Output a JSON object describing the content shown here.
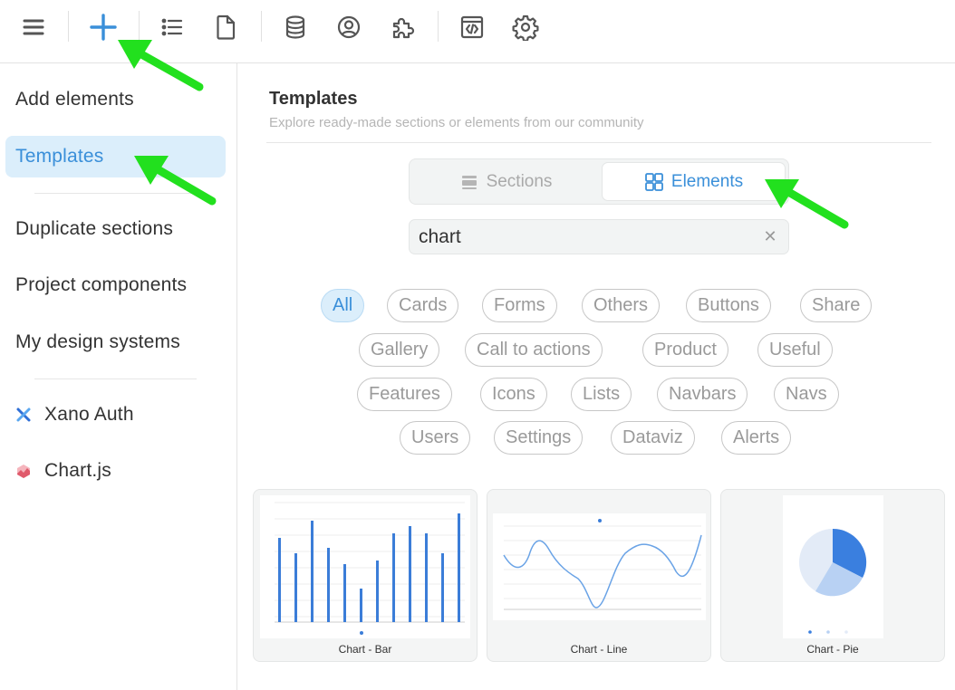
{
  "toolbar": {
    "buttons": [
      {
        "name": "menu-icon"
      },
      {
        "name": "plus-icon",
        "color": "#3a8fd9"
      },
      {
        "name": "list-icon"
      },
      {
        "name": "page-icon"
      },
      {
        "name": "database-icon"
      },
      {
        "name": "user-circle-icon"
      },
      {
        "name": "puzzle-icon"
      },
      {
        "name": "code-window-icon"
      },
      {
        "name": "gear-icon"
      }
    ]
  },
  "sidebar": {
    "items": [
      {
        "label": "Add elements"
      },
      {
        "label": "Templates",
        "active": true
      },
      {
        "label": "Duplicate sections"
      },
      {
        "label": "Project components"
      },
      {
        "label": "My design systems"
      }
    ],
    "extensions": [
      {
        "label": "Xano Auth",
        "icon": "xano-icon"
      },
      {
        "label": "Chart.js",
        "icon": "chartjs-icon"
      }
    ]
  },
  "main": {
    "title": "Templates",
    "subtitle": "Explore ready-made sections or elements from our community",
    "segments": {
      "sections": "Sections",
      "elements": "Elements",
      "selected": "Elements"
    },
    "search": {
      "value": "chart",
      "clear": "✕"
    },
    "tags": [
      "All",
      "Cards",
      "Forms",
      "Others",
      "Buttons",
      "Share",
      "Gallery",
      "Call to actions",
      "Product",
      "Useful",
      "Features",
      "Icons",
      "Lists",
      "Navbars",
      "Navs",
      "Users",
      "Settings",
      "Dataviz",
      "Alerts"
    ],
    "active_tag": "All",
    "cards": [
      {
        "label": "Chart - Bar"
      },
      {
        "label": "Chart - Line"
      },
      {
        "label": "Chart - Pie"
      }
    ]
  },
  "colors": {
    "accent": "#3a8fd9",
    "active_bg": "#dbeefb",
    "annotation_arrow": "#22e01e"
  }
}
